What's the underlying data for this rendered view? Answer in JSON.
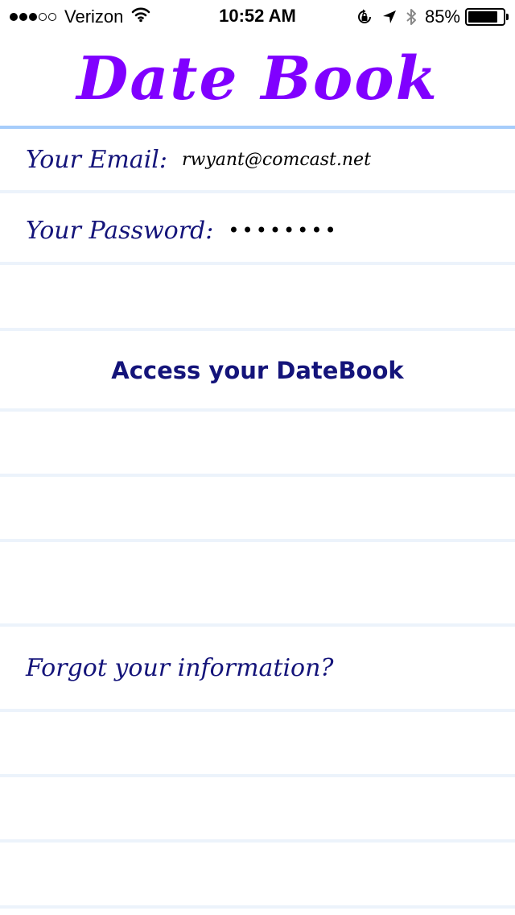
{
  "status_bar": {
    "signal_bars_filled": 3,
    "signal_bars_total": 5,
    "carrier": "Verizon",
    "time": "10:52 AM",
    "battery_percent": "85%",
    "battery_level": 0.85
  },
  "app": {
    "title": "Date Book",
    "title_color": "#8000ff",
    "text_color": "#14147a",
    "rule_color": "#ecf3fb",
    "header_rule_color": "#a6cdfb"
  },
  "login": {
    "email_label": "Your Email:",
    "email_value": "rwyant@comcast.net",
    "password_label": "Your Password:",
    "password_value": "••••••••",
    "access_button_label": "Access your DateBook",
    "forgot_link_label": "Forgot your information?"
  }
}
